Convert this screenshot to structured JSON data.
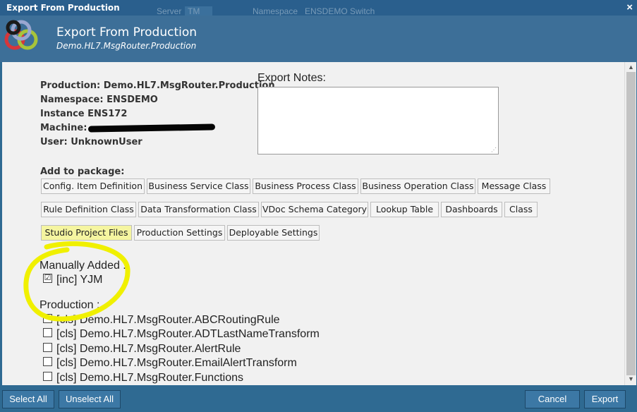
{
  "window": {
    "title": "Export From Production",
    "close_glyph": "×",
    "bg_text": [
      "Server",
      "TM",
      "Namespace",
      "ENSDEMO",
      "Switch"
    ]
  },
  "header": {
    "title": "Export From Production",
    "subtitle": "Demo.HL7.MsgRouter.Production"
  },
  "info": {
    "production": "Production: Demo.HL7.MsgRouter.Production",
    "namespace": "Namespace: ENSDEMO",
    "instance": "Instance ENS172",
    "machine_label": "Machine:",
    "user": "User: UnknownUser"
  },
  "notes": {
    "label": "Export Notes:",
    "value": ""
  },
  "package": {
    "label": "Add to package:",
    "buttons": [
      "Config. Item Definition",
      "Business Service Class",
      "Business Process Class",
      "Business Operation Class",
      "Message Class",
      "Rule Definition Class",
      "Data Transformation Class",
      "VDoc Schema Category",
      "Lookup Table",
      "Dashboards",
      "Class",
      "Studio Project Files",
      "Production Settings",
      "Deployable Settings"
    ]
  },
  "manual": {
    "label": "Manually Added :",
    "items": [
      {
        "label": "[inc] YJM",
        "checked": true
      }
    ]
  },
  "production_section": {
    "label": "Production :",
    "items": [
      "[cls] Demo.HL7.MsgRouter.ABCRoutingRule",
      "[cls] Demo.HL7.MsgRouter.ADTLastNameTransform",
      "[cls] Demo.HL7.MsgRouter.AlertRule",
      "[cls] Demo.HL7.MsgRouter.EmailAlertTransform",
      "[cls] Demo.HL7.MsgRouter.Functions"
    ]
  },
  "footer": {
    "select_all": "Select All",
    "unselect_all": "Unselect All",
    "cancel": "Cancel",
    "export": "Export"
  },
  "colors": {
    "title_bar": "#2a5f8d",
    "header": "#3d6f98",
    "button_bottom": "#3c78a5",
    "highlight": "#f0f000"
  },
  "icons": {
    "check": "☑",
    "scroll_up": "▲",
    "scroll_down": "▼"
  }
}
